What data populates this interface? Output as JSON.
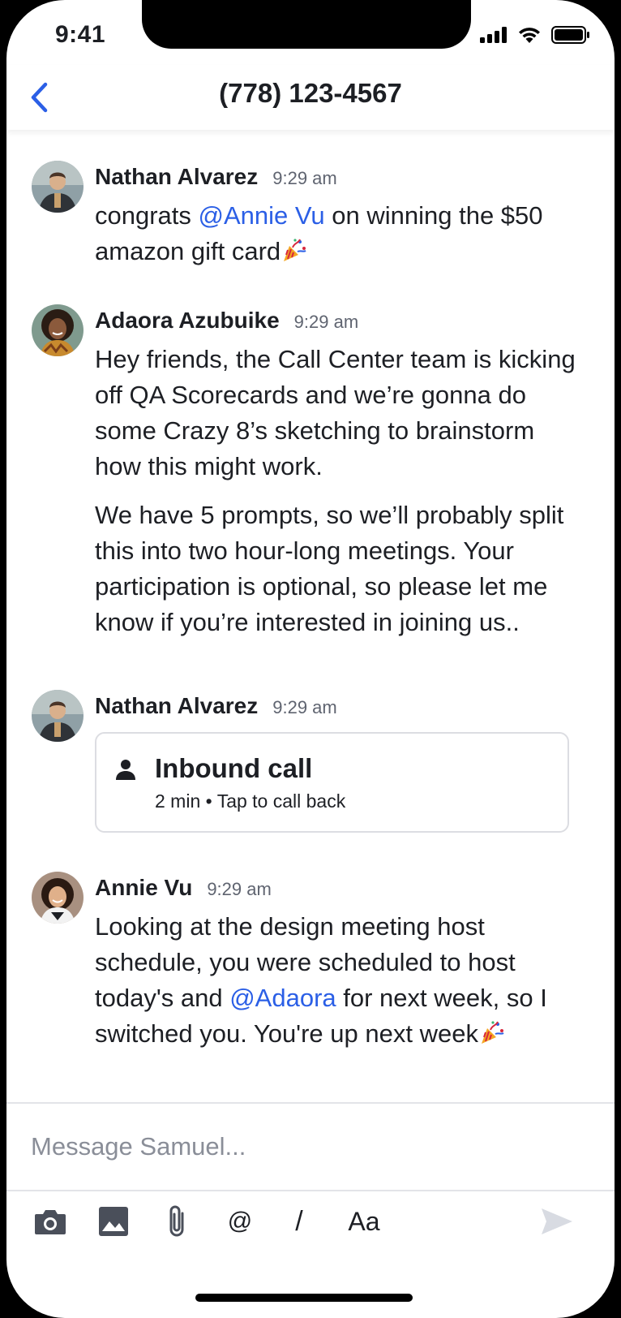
{
  "status_bar": {
    "time": "9:41"
  },
  "nav": {
    "title": "(778) 123-4567"
  },
  "messages": [
    {
      "name": "Nathan Alvarez",
      "time": "9:29 am",
      "text_1": "congrats ",
      "mention": "@Annie Vu",
      "text_2": " on winning the $50 amazon gift card",
      "emoji": "party-popper"
    },
    {
      "name": "Adaora Azubuike",
      "time": "9:29 am",
      "paragraph_1": "Hey friends, the Call Center team is kicking off QA Scorecards and we’re gonna do some Crazy 8’s sketching to brainstorm how this might work.",
      "paragraph_2": "We have 5 prompts, so we’ll probably split this into two hour-long meetings. Your participation is optional, so please let me know if you’re interested in joining us.."
    },
    {
      "name": "Nathan Alvarez",
      "time": "9:29 am",
      "call": {
        "title": "Inbound call",
        "duration": "2 min",
        "separator": "•",
        "action": "Tap to call back",
        "icon": "person-icon"
      }
    },
    {
      "name": "Annie Vu",
      "time": "9:29 am",
      "text_1": "Looking at the design meeting host schedule, you were scheduled to host today's and ",
      "mention": "@Adaora",
      "text_2": " for next week, so I switched you. You're up next week",
      "emoji": "party-popper"
    }
  ],
  "composer": {
    "placeholder": "Message Samuel..."
  },
  "toolbar": {
    "camera": "camera-icon",
    "image": "image-icon",
    "attach": "paperclip-icon",
    "mention_label": "@",
    "command_label": "/",
    "format_label": "Aa",
    "send": "send-icon"
  },
  "colors": {
    "accent": "#2b5fe6",
    "text": "#1d1f24",
    "muted": "#5f6470",
    "send_disabled": "#d8dbe2"
  }
}
